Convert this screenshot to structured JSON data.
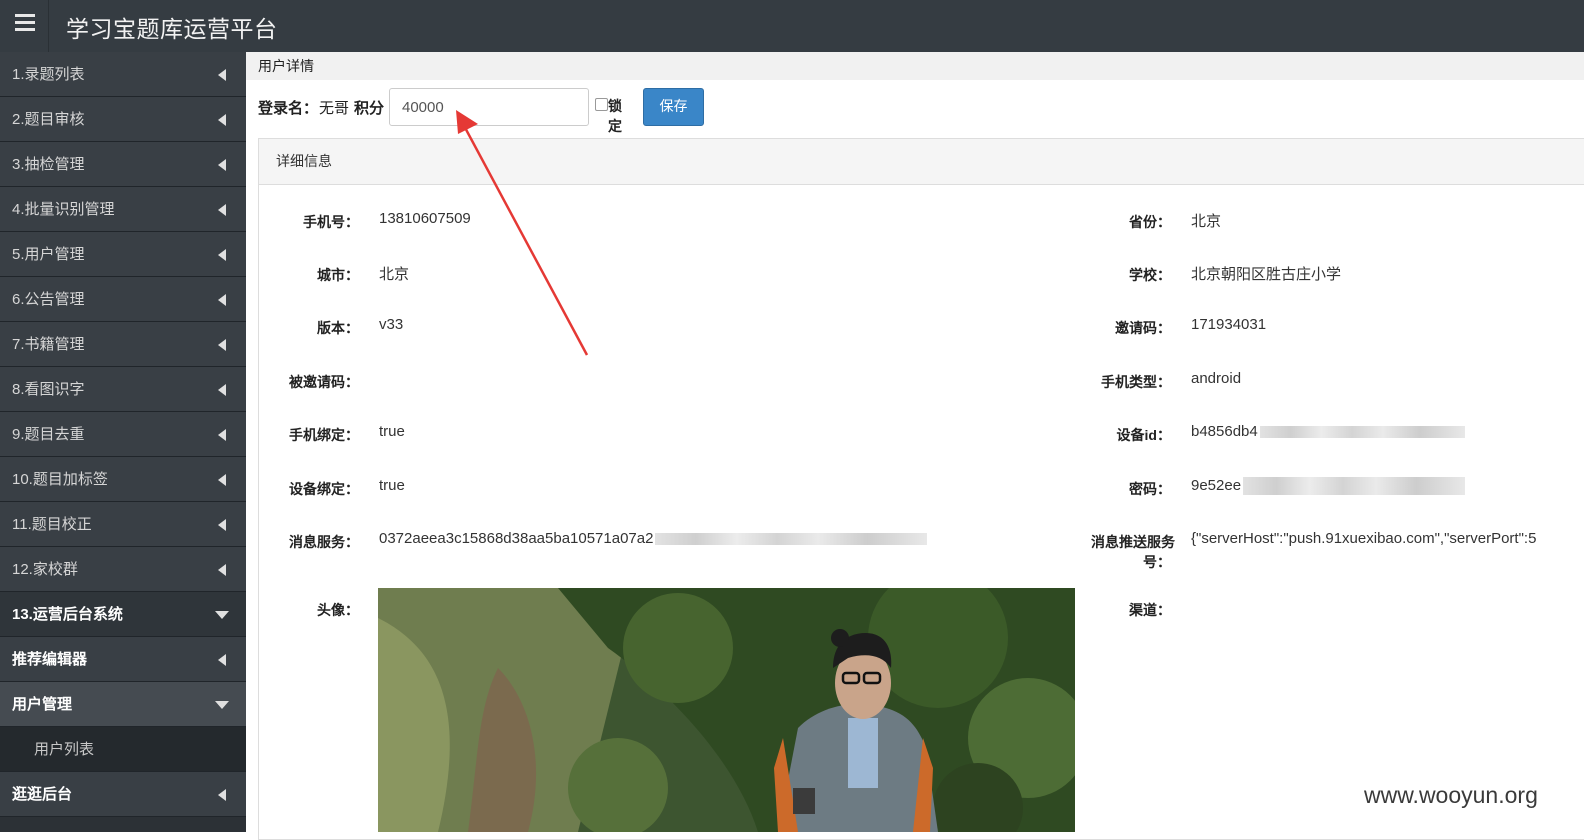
{
  "app": {
    "title": "学习宝题库运营平台"
  },
  "sidebar": {
    "items": [
      {
        "label": "1.录题列表"
      },
      {
        "label": "2.题目审核"
      },
      {
        "label": "3.抽检管理"
      },
      {
        "label": "4.批量识别管理"
      },
      {
        "label": "5.用户管理"
      },
      {
        "label": "6.公告管理"
      },
      {
        "label": "7.书籍管理"
      },
      {
        "label": "8.看图识字"
      },
      {
        "label": "9.题目去重"
      },
      {
        "label": "10.题目加标签"
      },
      {
        "label": "11.题目校正"
      },
      {
        "label": "12.家校群"
      },
      {
        "label": "13.运营后台系统"
      },
      {
        "label": "推荐编辑器"
      },
      {
        "label": "用户管理"
      },
      {
        "label": "用户列表"
      },
      {
        "label": "逛逛后台"
      }
    ]
  },
  "breadcrumb": "用户详情",
  "form": {
    "login_label": "登录名：",
    "login_value": "无哥",
    "score_label": "积分",
    "score_value": "40000",
    "lock_label": "锁定",
    "lock_checked": false,
    "save_label": "保存"
  },
  "panel": {
    "title": "详细信息"
  },
  "details": {
    "phone": {
      "label": "手机号：",
      "value": "13810607509"
    },
    "province": {
      "label": "省份：",
      "value": "北京"
    },
    "city": {
      "label": "城市：",
      "value": "北京"
    },
    "school": {
      "label": "学校：",
      "value": "北京朝阳区胜古庄小学"
    },
    "version": {
      "label": "版本：",
      "value": "v33"
    },
    "invite_code": {
      "label": "邀请码：",
      "value": "171934031"
    },
    "invited_code": {
      "label": "被邀请码：",
      "value": ""
    },
    "phone_type": {
      "label": "手机类型：",
      "value": "android"
    },
    "phone_bind": {
      "label": "手机绑定：",
      "value": "true"
    },
    "device_id": {
      "label": "设备id：",
      "value": "b4856db4"
    },
    "device_bind": {
      "label": "设备绑定：",
      "value": "true"
    },
    "password": {
      "label": "密码：",
      "value": "9e52ee"
    },
    "msg_service": {
      "label": "消息服务：",
      "value": "0372aeea3c15868d38aa5ba10571a07a2"
    },
    "push_service": {
      "label_1": "消息推送服务",
      "label_2": "号：",
      "value": "{\"serverHost\":\"push.91xuexibao.com\",\"serverPort\":5"
    },
    "avatar": {
      "label": "头像："
    },
    "channel": {
      "label": "渠道：",
      "value": ""
    }
  },
  "watermark": "www.wooyun.org",
  "colors": {
    "topbar": "#353c42",
    "sidebar": "#393f45",
    "primary": "#3a86c8",
    "annotation": "#e53935"
  }
}
